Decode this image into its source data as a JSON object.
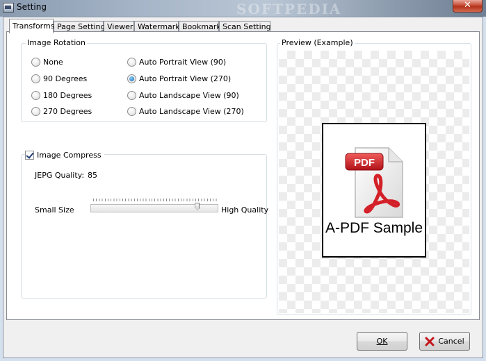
{
  "window": {
    "title": "Setting",
    "watermark": "SOFTPEDIA",
    "close_glyph": "✕"
  },
  "tabs": [
    {
      "label": "Transforms",
      "active": true
    },
    {
      "label": "Page Setting",
      "active": false
    },
    {
      "label": "Viewer",
      "active": false
    },
    {
      "label": "Watermark",
      "active": false
    },
    {
      "label": "Bookmark",
      "active": false
    },
    {
      "label": "Scan Setting",
      "active": false
    }
  ],
  "image_rotation": {
    "title": "Image Rotation",
    "options": [
      {
        "label": "None",
        "checked": false
      },
      {
        "label": "90 Degrees",
        "checked": false
      },
      {
        "label": "180 Degrees",
        "checked": false
      },
      {
        "label": "270 Degrees",
        "checked": false
      },
      {
        "label": "Auto Portrait View (90)",
        "checked": false
      },
      {
        "label": "Auto Portrait View (270)",
        "checked": true
      },
      {
        "label": "Auto Landscape View (90)",
        "checked": false
      },
      {
        "label": "Auto Landscape View (270)",
        "checked": false
      }
    ]
  },
  "image_compress": {
    "label": "Image Compress",
    "checked": true,
    "jpeg_quality_label": "JEPG Quality:",
    "jpeg_quality_value": "85",
    "slider_min_label": "Small Size",
    "slider_max_label": "High Quality",
    "slider_fraction": 0.85
  },
  "preview": {
    "title": "Preview (Example)",
    "sample_text": "A-PDF Sample",
    "pdf_badge": "PDF"
  },
  "buttons": {
    "ok": "OK",
    "cancel": "Cancel"
  },
  "colors": {
    "pdf_red": "#d42028",
    "accent_blue": "#1e5aa8"
  }
}
